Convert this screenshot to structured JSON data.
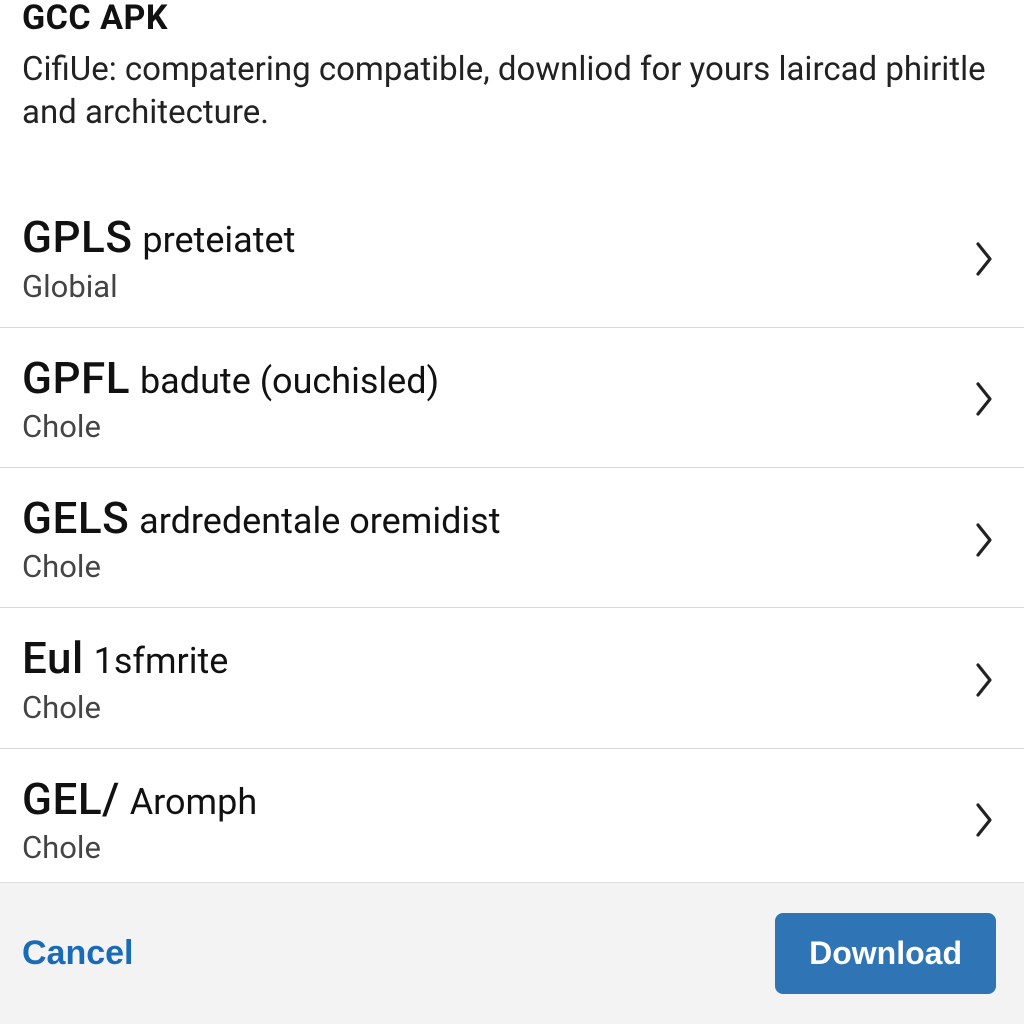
{
  "header": {
    "title": "GCC APK",
    "subtitle": "CifiUe: compatering compatible, downliod for yours laircad phiritle and architecture."
  },
  "items": [
    {
      "lead": "GPLS",
      "rest": "preteiatet",
      "sub": "Globial"
    },
    {
      "lead": "GPFL",
      "rest": "badute (ouchisled)",
      "sub": "Chole"
    },
    {
      "lead": "GELS",
      "rest": "ardredentale oremidist",
      "sub": "Chole"
    },
    {
      "lead": "Eul",
      "rest": "1sfmrite",
      "sub": "Chole"
    },
    {
      "lead": "GEL/",
      "rest": "Aromph",
      "sub": "Chole"
    }
  ],
  "footer": {
    "cancel": "Cancel",
    "download": "Download"
  }
}
